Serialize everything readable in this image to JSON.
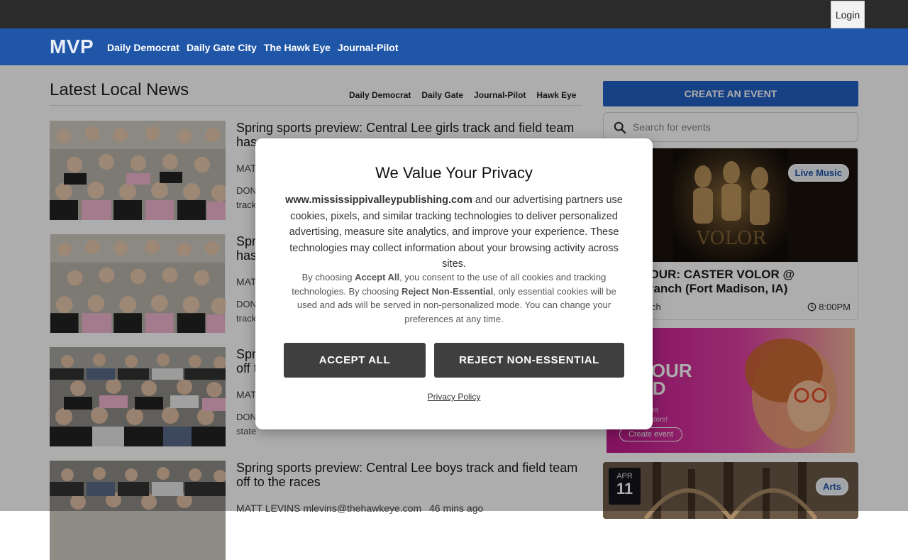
{
  "topbar": {
    "login_label": "Login"
  },
  "nav": {
    "brand": "MVP",
    "links": [
      "Daily Democrat",
      "Daily Gate City",
      "The Hawk Eye",
      "Journal-Pilot"
    ]
  },
  "news": {
    "title": "Latest Local News",
    "tabs": [
      "Daily Democrat",
      "Daily Gate",
      "Journal-Pilot",
      "Hawk Eye"
    ],
    "articles": [
      {
        "headline": "Spring sports preview: Central Lee girls track and field team has big goals",
        "byline": "MATT LEVINS mlevins@thehawkeye.com",
        "snippet": "DONNELLSON — The Central Lee girls track and field team",
        "visible_headline": "Spring sports preview: Central Lee girls track and field team has",
        "visible_byline": "MAT",
        "visible_snippet": "DON",
        "visible_snippet2": "track"
      },
      {
        "visible_headline": "Spr",
        "visible_headline2": "has",
        "visible_byline": "MAT",
        "visible_snippet": "DON",
        "visible_snippet2": "track"
      },
      {
        "visible_headline": "Spr",
        "visible_headline2": "off t",
        "visible_byline": "MAT",
        "visible_snippet": "DON",
        "visible_snippet2": "state"
      },
      {
        "headline": "Spring sports preview: Central Lee boys track and field team off to the races",
        "byline": "MATT LEVINS mlevins@thehawkeye.com",
        "time": "46 mins ago"
      }
    ]
  },
  "sidebar": {
    "create_label": "CREATE AN EVENT",
    "search_placeholder": "Search for events",
    "event1": {
      "badge": "Live Music",
      "title": "DSM TOUR: CASTER VOLOR @ Longbranch (Fort Madison, IA)",
      "venue": "Longbranch",
      "time": "8:00PM"
    },
    "ad": {
      "line1": "D YOUR",
      "line2": "OWD",
      "small1": "ting & event",
      "small2": "event creators!",
      "button": "Create event"
    },
    "event2": {
      "month": "APR",
      "day": "11",
      "badge": "Arts"
    }
  },
  "modal": {
    "title": "We Value Your Privacy",
    "site": "www.mississippivalleypublishing.com",
    "body": "and our advertising partners use cookies, pixels, and similar tracking technologies to deliver personalized advertising, measure site analytics, and improve your experience. These technologies may collect information about your browsing activity across sites.",
    "small_p1": "By choosing",
    "small_accept": "Accept All",
    "small_p2": ", you consent to the use of all cookies and tracking technologies. By choosing",
    "small_reject": "Reject Non-Essential",
    "small_p3": ", only essential cookies will be used and ads will be served in non-personalized mode. You can change your preferences at any time.",
    "accept_label": "ACCEPT ALL",
    "reject_label": "REJECT NON-ESSENTIAL",
    "privacy_label": "Privacy Policy"
  }
}
